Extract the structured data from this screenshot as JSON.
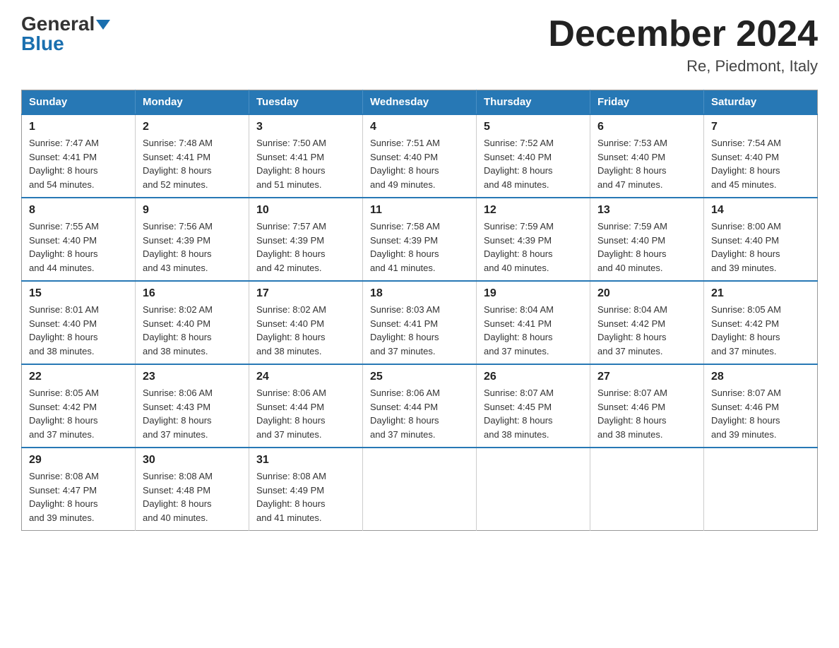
{
  "header": {
    "logo_general": "General",
    "logo_blue": "Blue",
    "month_title": "December 2024",
    "location": "Re, Piedmont, Italy"
  },
  "weekdays": [
    "Sunday",
    "Monday",
    "Tuesday",
    "Wednesday",
    "Thursday",
    "Friday",
    "Saturday"
  ],
  "weeks": [
    [
      {
        "day": "1",
        "sunrise": "7:47 AM",
        "sunset": "4:41 PM",
        "daylight": "8 hours and 54 minutes."
      },
      {
        "day": "2",
        "sunrise": "7:48 AM",
        "sunset": "4:41 PM",
        "daylight": "8 hours and 52 minutes."
      },
      {
        "day": "3",
        "sunrise": "7:50 AM",
        "sunset": "4:41 PM",
        "daylight": "8 hours and 51 minutes."
      },
      {
        "day": "4",
        "sunrise": "7:51 AM",
        "sunset": "4:40 PM",
        "daylight": "8 hours and 49 minutes."
      },
      {
        "day": "5",
        "sunrise": "7:52 AM",
        "sunset": "4:40 PM",
        "daylight": "8 hours and 48 minutes."
      },
      {
        "day": "6",
        "sunrise": "7:53 AM",
        "sunset": "4:40 PM",
        "daylight": "8 hours and 47 minutes."
      },
      {
        "day": "7",
        "sunrise": "7:54 AM",
        "sunset": "4:40 PM",
        "daylight": "8 hours and 45 minutes."
      }
    ],
    [
      {
        "day": "8",
        "sunrise": "7:55 AM",
        "sunset": "4:40 PM",
        "daylight": "8 hours and 44 minutes."
      },
      {
        "day": "9",
        "sunrise": "7:56 AM",
        "sunset": "4:39 PM",
        "daylight": "8 hours and 43 minutes."
      },
      {
        "day": "10",
        "sunrise": "7:57 AM",
        "sunset": "4:39 PM",
        "daylight": "8 hours and 42 minutes."
      },
      {
        "day": "11",
        "sunrise": "7:58 AM",
        "sunset": "4:39 PM",
        "daylight": "8 hours and 41 minutes."
      },
      {
        "day": "12",
        "sunrise": "7:59 AM",
        "sunset": "4:39 PM",
        "daylight": "8 hours and 40 minutes."
      },
      {
        "day": "13",
        "sunrise": "7:59 AM",
        "sunset": "4:40 PM",
        "daylight": "8 hours and 40 minutes."
      },
      {
        "day": "14",
        "sunrise": "8:00 AM",
        "sunset": "4:40 PM",
        "daylight": "8 hours and 39 minutes."
      }
    ],
    [
      {
        "day": "15",
        "sunrise": "8:01 AM",
        "sunset": "4:40 PM",
        "daylight": "8 hours and 38 minutes."
      },
      {
        "day": "16",
        "sunrise": "8:02 AM",
        "sunset": "4:40 PM",
        "daylight": "8 hours and 38 minutes."
      },
      {
        "day": "17",
        "sunrise": "8:02 AM",
        "sunset": "4:40 PM",
        "daylight": "8 hours and 38 minutes."
      },
      {
        "day": "18",
        "sunrise": "8:03 AM",
        "sunset": "4:41 PM",
        "daylight": "8 hours and 37 minutes."
      },
      {
        "day": "19",
        "sunrise": "8:04 AM",
        "sunset": "4:41 PM",
        "daylight": "8 hours and 37 minutes."
      },
      {
        "day": "20",
        "sunrise": "8:04 AM",
        "sunset": "4:42 PM",
        "daylight": "8 hours and 37 minutes."
      },
      {
        "day": "21",
        "sunrise": "8:05 AM",
        "sunset": "4:42 PM",
        "daylight": "8 hours and 37 minutes."
      }
    ],
    [
      {
        "day": "22",
        "sunrise": "8:05 AM",
        "sunset": "4:42 PM",
        "daylight": "8 hours and 37 minutes."
      },
      {
        "day": "23",
        "sunrise": "8:06 AM",
        "sunset": "4:43 PM",
        "daylight": "8 hours and 37 minutes."
      },
      {
        "day": "24",
        "sunrise": "8:06 AM",
        "sunset": "4:44 PM",
        "daylight": "8 hours and 37 minutes."
      },
      {
        "day": "25",
        "sunrise": "8:06 AM",
        "sunset": "4:44 PM",
        "daylight": "8 hours and 37 minutes."
      },
      {
        "day": "26",
        "sunrise": "8:07 AM",
        "sunset": "4:45 PM",
        "daylight": "8 hours and 38 minutes."
      },
      {
        "day": "27",
        "sunrise": "8:07 AM",
        "sunset": "4:46 PM",
        "daylight": "8 hours and 38 minutes."
      },
      {
        "day": "28",
        "sunrise": "8:07 AM",
        "sunset": "4:46 PM",
        "daylight": "8 hours and 39 minutes."
      }
    ],
    [
      {
        "day": "29",
        "sunrise": "8:08 AM",
        "sunset": "4:47 PM",
        "daylight": "8 hours and 39 minutes."
      },
      {
        "day": "30",
        "sunrise": "8:08 AM",
        "sunset": "4:48 PM",
        "daylight": "8 hours and 40 minutes."
      },
      {
        "day": "31",
        "sunrise": "8:08 AM",
        "sunset": "4:49 PM",
        "daylight": "8 hours and 41 minutes."
      },
      null,
      null,
      null,
      null
    ]
  ],
  "labels": {
    "sunrise": "Sunrise: ",
    "sunset": "Sunset: ",
    "daylight": "Daylight: "
  }
}
